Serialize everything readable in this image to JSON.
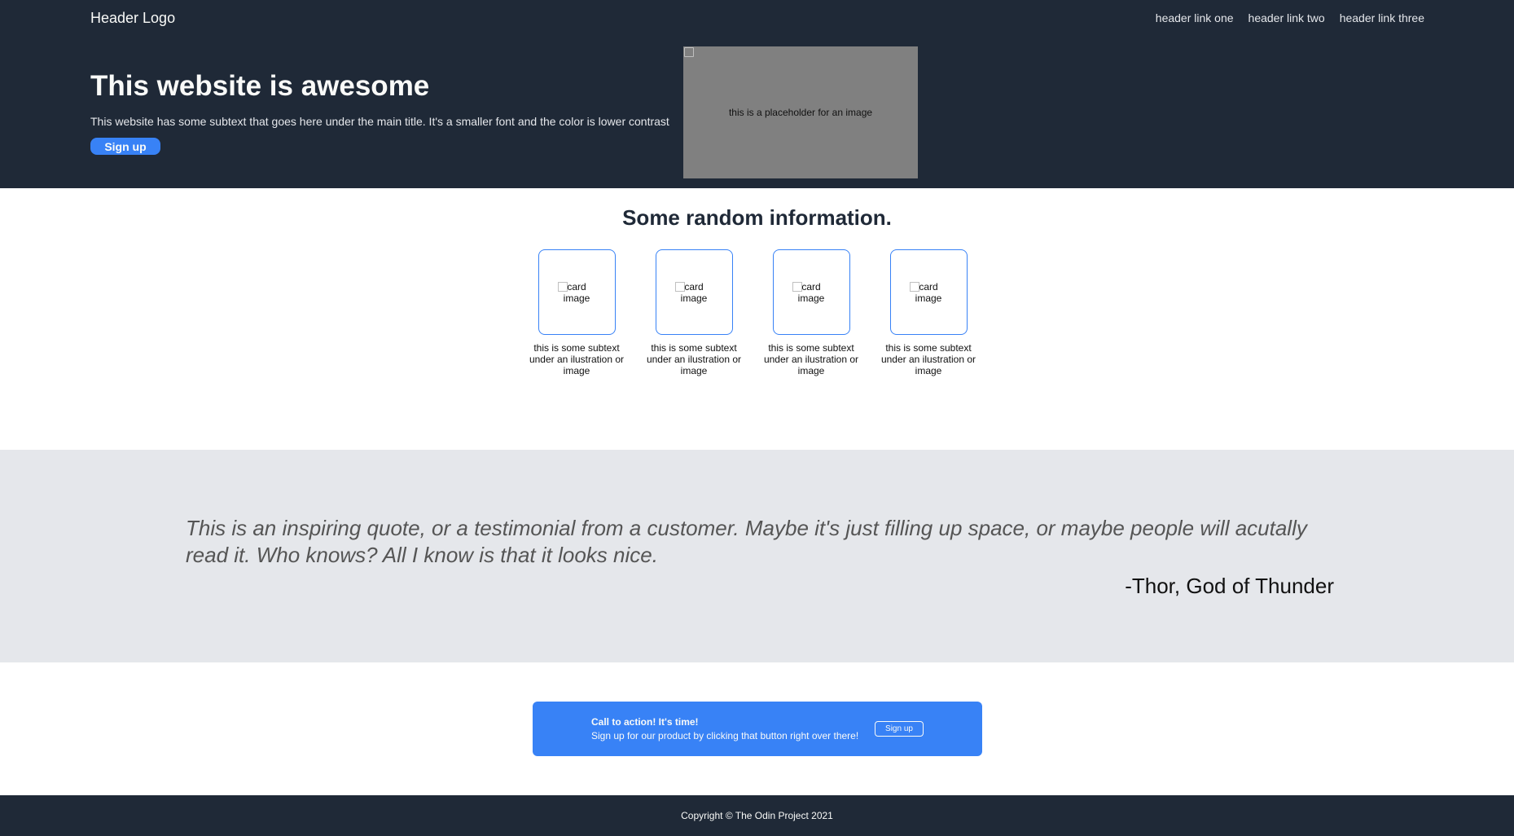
{
  "header": {
    "logo": "Header Logo",
    "nav": [
      "header link one",
      "header link two",
      "header link three"
    ]
  },
  "hero": {
    "title": "This website is awesome",
    "subtext": "This website has some subtext that goes here under the main title. It's a smaller font and the color is lower contrast",
    "signup_label": "Sign up",
    "image_alt": "this is a placeholder for an image"
  },
  "info": {
    "title": "Some random information.",
    "cards": [
      {
        "image_alt": "card image",
        "text": "this is some subtext under an ilustration or image"
      },
      {
        "image_alt": "card image",
        "text": "this is some subtext under an ilustration or image"
      },
      {
        "image_alt": "card image",
        "text": "this is some subtext under an ilustration or image"
      },
      {
        "image_alt": "card image",
        "text": "this is some subtext under an ilustration or image"
      }
    ]
  },
  "quote": {
    "text": "This is an inspiring quote, or a testimonial from a customer. Maybe it's just filling up space, or maybe people will acutally read it. Who knows? All I know is that it looks nice.",
    "author": "-Thor, God of Thunder"
  },
  "cta": {
    "title": "Call to action! It's time!",
    "subtext": "Sign up for our product by clicking that button right over there!",
    "button_label": "Sign up"
  },
  "footer": {
    "copyright": "Copyright © The Odin Project 2021"
  },
  "colors": {
    "dark": "#1f2937",
    "accent": "#3882f6",
    "light_gray": "#e5e7eb",
    "off_white": "#f9faf8"
  }
}
